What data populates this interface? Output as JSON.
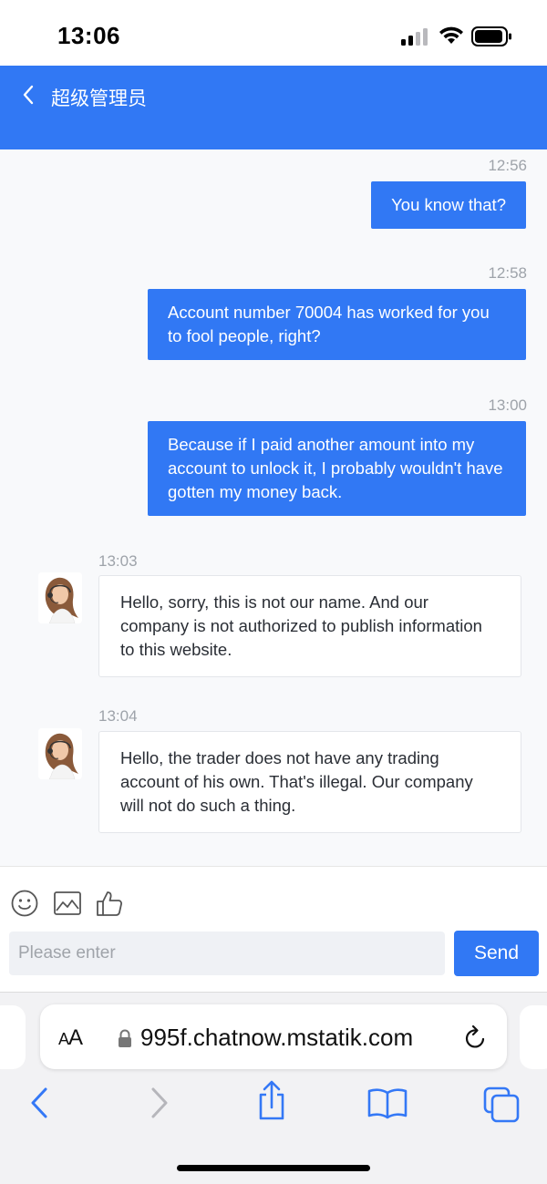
{
  "status_bar": {
    "time": "13:06"
  },
  "header": {
    "title": "超级管理员"
  },
  "messages": [
    {
      "time": "12:56",
      "text": "You know that?"
    },
    {
      "time": "12:58",
      "text": "Account number 70004 has worked for you to fool people, right?"
    },
    {
      "time": "13:00",
      "text": "Because if I paid another amount into my account to unlock it, I probably wouldn't have gotten my money back."
    },
    {
      "time": "13:03",
      "text": "Hello, sorry, this is not our name. And our company is not authorized to publish information to this website."
    },
    {
      "time": "13:04",
      "text": "Hello, the trader does not have any trading account of his own. That's illegal. Our company will not do such a thing."
    }
  ],
  "input": {
    "placeholder": "Please enter",
    "value": "",
    "send_label": "Send"
  },
  "browser": {
    "aa_label_small": "A",
    "aa_label_large": "A",
    "url": "995f.chatnow.mstatik.com"
  },
  "colors": {
    "accent": "#3178f4",
    "chat_bg": "#f8f9fb"
  },
  "icons": [
    "back-chevron-icon",
    "emoji-icon",
    "image-icon",
    "thumbs-up-icon",
    "lock-icon",
    "reload-icon",
    "back-arrow-icon",
    "forward-arrow-icon",
    "share-icon",
    "bookmarks-icon",
    "tabs-icon"
  ]
}
